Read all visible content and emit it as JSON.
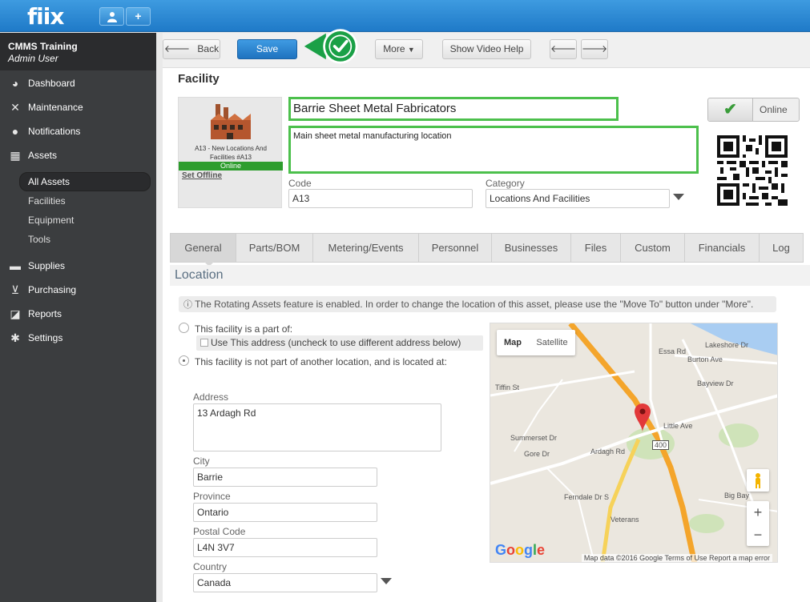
{
  "topbar": {
    "logo": "fiix",
    "user_btn": "user-icon",
    "add_btn": "+"
  },
  "sidebar": {
    "org_name": "CMMS Training",
    "org_user": "Admin User",
    "items": [
      {
        "label": "Dashboard",
        "icon": "dashboard-icon"
      },
      {
        "label": "Maintenance",
        "icon": "wrench-icon"
      },
      {
        "label": "Notifications",
        "icon": "chat-icon"
      },
      {
        "label": "Assets",
        "icon": "boxes-icon"
      },
      {
        "label": "Supplies",
        "icon": "truck-icon"
      },
      {
        "label": "Purchasing",
        "icon": "cart-icon"
      },
      {
        "label": "Reports",
        "icon": "chart-icon"
      },
      {
        "label": "Settings",
        "icon": "gear-icon"
      }
    ],
    "subitems": [
      "All Assets",
      "Facilities",
      "Equipment",
      "Tools"
    ]
  },
  "toolbar": {
    "back": "Back",
    "save": "Save",
    "more": "More",
    "video": "Show Video Help"
  },
  "page": {
    "title": "Facility",
    "image_caption": "A13 - New Locations And Facilities #A13",
    "status": "Online",
    "set_offline": "Set Offline",
    "name": "Barrie Sheet Metal Fabricators",
    "description": "Main sheet metal manufacturing location",
    "code_label": "Code",
    "code": "A13",
    "category_label": "Category",
    "category": "Locations And Facilities",
    "online_toggle": "Online"
  },
  "tabs": [
    "General",
    "Parts/BOM",
    "Metering/Events",
    "Personnel",
    "Businesses",
    "Files",
    "Custom",
    "Financials",
    "Log"
  ],
  "location": {
    "header": "Location",
    "info": "The Rotating Assets feature is enabled. In order to change the location of this asset, please use the \"Move To\" button under \"More\".",
    "opt1": "This facility is a part of:",
    "use_address": "Use This address (uncheck to use different address below)",
    "opt2": "This facility is not part of another location, and is located at:",
    "address_label": "Address",
    "address": "13 Ardagh Rd",
    "city_label": "City",
    "city": "Barrie",
    "province_label": "Province",
    "province": "Ontario",
    "postal_label": "Postal Code",
    "postal": "L4N 3V7",
    "country_label": "Country",
    "country": "Canada"
  },
  "map": {
    "map_btn": "Map",
    "satellite_btn": "Satellite",
    "footer": "Map data ©2016 Google   Terms of Use   Report a map error",
    "logo": "Google",
    "labels": [
      "Lakeshore Dr",
      "Burton Ave",
      "Tiffin St",
      "Essa Rd",
      "Bayview Dr",
      "Little Ave",
      "Summerset Dr",
      "Gore Dr",
      "Ardagh Rd",
      "Ferndale Dr S",
      "Veterans",
      "Big Bay",
      "400"
    ]
  }
}
